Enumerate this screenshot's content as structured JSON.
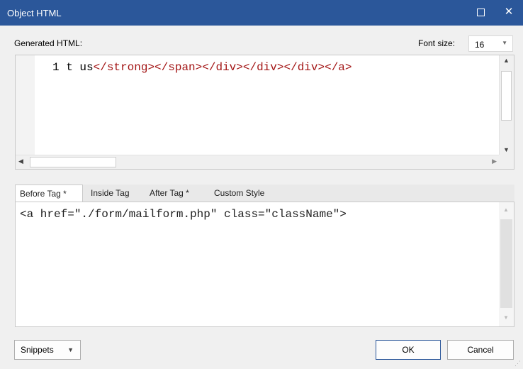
{
  "window": {
    "title": "Object HTML"
  },
  "generated": {
    "label": "Generated HTML:",
    "font_size_label": "Font size:",
    "font_size_value": "16",
    "code": {
      "line_no": "1",
      "text_prefix": "t us",
      "tags": [
        "</strong>",
        "</span>",
        "</div>",
        "</div>",
        "</div>",
        "</a>"
      ]
    }
  },
  "tabs": [
    {
      "label": "Before Tag *",
      "active": true
    },
    {
      "label": "Inside Tag",
      "active": false
    },
    {
      "label": "After Tag *",
      "active": false
    },
    {
      "label": "Custom Style",
      "active": false
    }
  ],
  "editor": {
    "content": "<a href=\"./form/mailform.php\" class=\"className\">"
  },
  "buttons": {
    "snippets": "Snippets",
    "ok": "OK",
    "cancel": "Cancel"
  },
  "colors": {
    "titlebar": "#2b579a",
    "tag": "#a31515"
  }
}
